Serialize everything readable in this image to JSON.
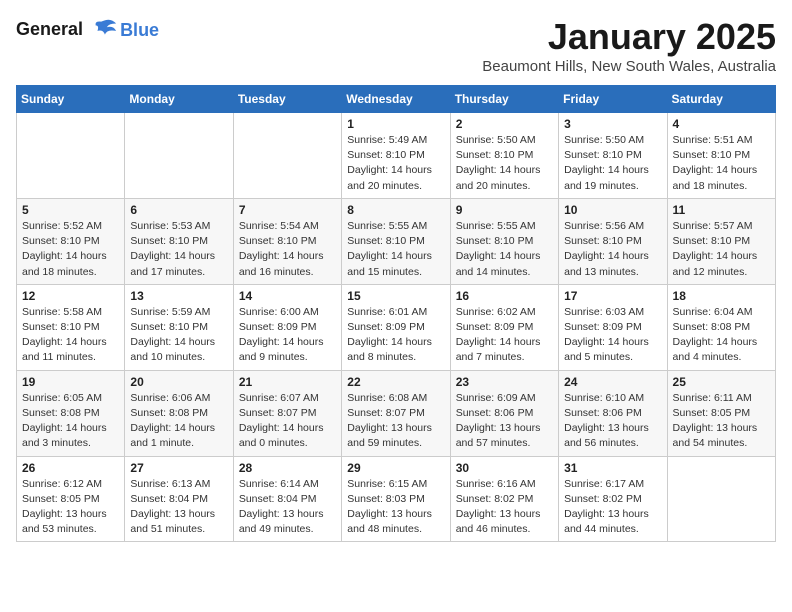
{
  "header": {
    "logo_line1": "General",
    "logo_line2": "Blue",
    "month_title": "January 2025",
    "location": "Beaumont Hills, New South Wales, Australia"
  },
  "weekdays": [
    "Sunday",
    "Monday",
    "Tuesday",
    "Wednesday",
    "Thursday",
    "Friday",
    "Saturday"
  ],
  "weeks": [
    [
      {
        "day": "",
        "info": ""
      },
      {
        "day": "",
        "info": ""
      },
      {
        "day": "",
        "info": ""
      },
      {
        "day": "1",
        "info": "Sunrise: 5:49 AM\nSunset: 8:10 PM\nDaylight: 14 hours\nand 20 minutes."
      },
      {
        "day": "2",
        "info": "Sunrise: 5:50 AM\nSunset: 8:10 PM\nDaylight: 14 hours\nand 20 minutes."
      },
      {
        "day": "3",
        "info": "Sunrise: 5:50 AM\nSunset: 8:10 PM\nDaylight: 14 hours\nand 19 minutes."
      },
      {
        "day": "4",
        "info": "Sunrise: 5:51 AM\nSunset: 8:10 PM\nDaylight: 14 hours\nand 18 minutes."
      }
    ],
    [
      {
        "day": "5",
        "info": "Sunrise: 5:52 AM\nSunset: 8:10 PM\nDaylight: 14 hours\nand 18 minutes."
      },
      {
        "day": "6",
        "info": "Sunrise: 5:53 AM\nSunset: 8:10 PM\nDaylight: 14 hours\nand 17 minutes."
      },
      {
        "day": "7",
        "info": "Sunrise: 5:54 AM\nSunset: 8:10 PM\nDaylight: 14 hours\nand 16 minutes."
      },
      {
        "day": "8",
        "info": "Sunrise: 5:55 AM\nSunset: 8:10 PM\nDaylight: 14 hours\nand 15 minutes."
      },
      {
        "day": "9",
        "info": "Sunrise: 5:55 AM\nSunset: 8:10 PM\nDaylight: 14 hours\nand 14 minutes."
      },
      {
        "day": "10",
        "info": "Sunrise: 5:56 AM\nSunset: 8:10 PM\nDaylight: 14 hours\nand 13 minutes."
      },
      {
        "day": "11",
        "info": "Sunrise: 5:57 AM\nSunset: 8:10 PM\nDaylight: 14 hours\nand 12 minutes."
      }
    ],
    [
      {
        "day": "12",
        "info": "Sunrise: 5:58 AM\nSunset: 8:10 PM\nDaylight: 14 hours\nand 11 minutes."
      },
      {
        "day": "13",
        "info": "Sunrise: 5:59 AM\nSunset: 8:10 PM\nDaylight: 14 hours\nand 10 minutes."
      },
      {
        "day": "14",
        "info": "Sunrise: 6:00 AM\nSunset: 8:09 PM\nDaylight: 14 hours\nand 9 minutes."
      },
      {
        "day": "15",
        "info": "Sunrise: 6:01 AM\nSunset: 8:09 PM\nDaylight: 14 hours\nand 8 minutes."
      },
      {
        "day": "16",
        "info": "Sunrise: 6:02 AM\nSunset: 8:09 PM\nDaylight: 14 hours\nand 7 minutes."
      },
      {
        "day": "17",
        "info": "Sunrise: 6:03 AM\nSunset: 8:09 PM\nDaylight: 14 hours\nand 5 minutes."
      },
      {
        "day": "18",
        "info": "Sunrise: 6:04 AM\nSunset: 8:08 PM\nDaylight: 14 hours\nand 4 minutes."
      }
    ],
    [
      {
        "day": "19",
        "info": "Sunrise: 6:05 AM\nSunset: 8:08 PM\nDaylight: 14 hours\nand 3 minutes."
      },
      {
        "day": "20",
        "info": "Sunrise: 6:06 AM\nSunset: 8:08 PM\nDaylight: 14 hours\nand 1 minute."
      },
      {
        "day": "21",
        "info": "Sunrise: 6:07 AM\nSunset: 8:07 PM\nDaylight: 14 hours\nand 0 minutes."
      },
      {
        "day": "22",
        "info": "Sunrise: 6:08 AM\nSunset: 8:07 PM\nDaylight: 13 hours\nand 59 minutes."
      },
      {
        "day": "23",
        "info": "Sunrise: 6:09 AM\nSunset: 8:06 PM\nDaylight: 13 hours\nand 57 minutes."
      },
      {
        "day": "24",
        "info": "Sunrise: 6:10 AM\nSunset: 8:06 PM\nDaylight: 13 hours\nand 56 minutes."
      },
      {
        "day": "25",
        "info": "Sunrise: 6:11 AM\nSunset: 8:05 PM\nDaylight: 13 hours\nand 54 minutes."
      }
    ],
    [
      {
        "day": "26",
        "info": "Sunrise: 6:12 AM\nSunset: 8:05 PM\nDaylight: 13 hours\nand 53 minutes."
      },
      {
        "day": "27",
        "info": "Sunrise: 6:13 AM\nSunset: 8:04 PM\nDaylight: 13 hours\nand 51 minutes."
      },
      {
        "day": "28",
        "info": "Sunrise: 6:14 AM\nSunset: 8:04 PM\nDaylight: 13 hours\nand 49 minutes."
      },
      {
        "day": "29",
        "info": "Sunrise: 6:15 AM\nSunset: 8:03 PM\nDaylight: 13 hours\nand 48 minutes."
      },
      {
        "day": "30",
        "info": "Sunrise: 6:16 AM\nSunset: 8:02 PM\nDaylight: 13 hours\nand 46 minutes."
      },
      {
        "day": "31",
        "info": "Sunrise: 6:17 AM\nSunset: 8:02 PM\nDaylight: 13 hours\nand 44 minutes."
      },
      {
        "day": "",
        "info": ""
      }
    ]
  ]
}
